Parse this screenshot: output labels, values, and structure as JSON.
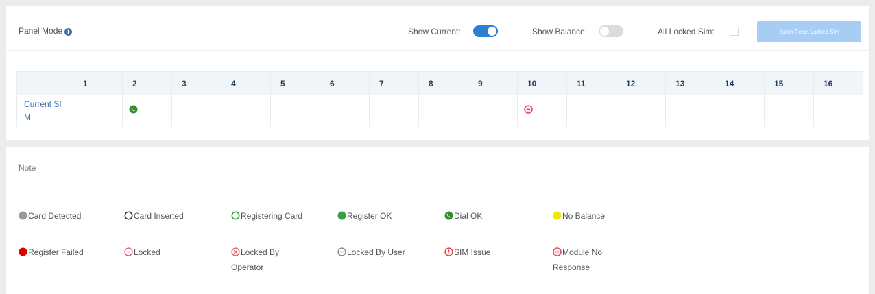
{
  "panel": {
    "title": "Panel Mode",
    "info_icon": "info-icon",
    "show_current_label": "Show Current:",
    "show_current_on": true,
    "show_balance_label": "Show Balance:",
    "show_balance_on": false,
    "all_locked_label": "All Locked Sim:",
    "all_locked_checked": false,
    "batch_button": "Batch Reset Locked Sim"
  },
  "grid": {
    "columns": [
      "1",
      "2",
      "3",
      "4",
      "5",
      "6",
      "7",
      "8",
      "9",
      "10",
      "11",
      "12",
      "13",
      "14",
      "15",
      "16"
    ],
    "row_label_line1": "Current SI",
    "row_label_line2": "M",
    "cells": [
      {
        "col": 2,
        "icon": "dial-ok-icon"
      },
      {
        "col": 10,
        "icon": "module-no-response-icon"
      }
    ]
  },
  "note": {
    "title": "Note",
    "legend": [
      {
        "label": "Card Detected",
        "icon": "card-detected-icon"
      },
      {
        "label": "Card Inserted",
        "icon": "card-inserted-icon"
      },
      {
        "label": "Registering Card",
        "icon": "registering-card-icon"
      },
      {
        "label": "Register OK",
        "icon": "register-ok-icon"
      },
      {
        "label": "Dial OK",
        "icon": "dial-ok-icon"
      },
      {
        "label": "No Balance",
        "icon": "no-balance-icon"
      },
      {
        "label": "Register Failed",
        "icon": "register-failed-icon"
      },
      {
        "label": "Locked",
        "icon": "locked-icon"
      },
      {
        "label_line1": "Locked By",
        "label_line2": "Operator",
        "icon": "locked-by-operator-icon"
      },
      {
        "label": "Locked By User",
        "icon": "locked-by-user-icon"
      },
      {
        "label": "SIM Issue",
        "icon": "sim-issue-icon"
      },
      {
        "label_line1": "Module No",
        "label_line2": "Response",
        "icon": "module-no-response-icon"
      }
    ]
  },
  "colors": {
    "accent": "#2d7fd6",
    "register_ok": "#34a043",
    "dial_ok": "#2f8f3a",
    "no_balance": "#f2e600",
    "register_failed": "#e00000",
    "locked": "#e05a6a",
    "card_detected": "#9a9a9a"
  }
}
